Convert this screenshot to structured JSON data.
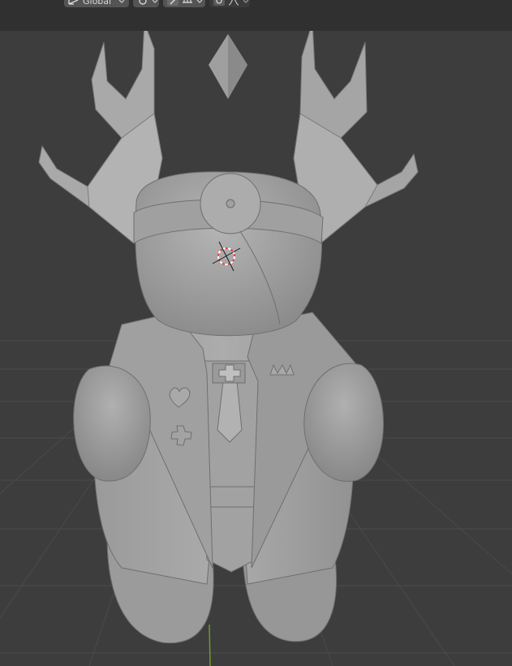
{
  "header": {
    "transform_orientation": {
      "label": "Global",
      "icon": "transform-orientation-icon",
      "chevron": "chevron-down-icon"
    },
    "pivot": {
      "icon": "pivot-point-icon",
      "chevron": "chevron-down-icon"
    },
    "snap": {
      "icon": "snap-magnet-icon",
      "target_icon": "snap-increment-icon",
      "chevron": "chevron-down-icon"
    },
    "proportional_editing": {
      "icon": "proportional-editing-icon",
      "falloff_icon": "falloff-curve-icon",
      "chevron": "chevron-down-icon"
    }
  },
  "viewport": {
    "background_color": "#3d3d3d",
    "grid_color": "#4a4a4a",
    "y_axis_color": "#6f9a2c",
    "model_color": "#a4a4a4",
    "cursor_colors": [
      "#e04040",
      "#ffffff"
    ]
  }
}
